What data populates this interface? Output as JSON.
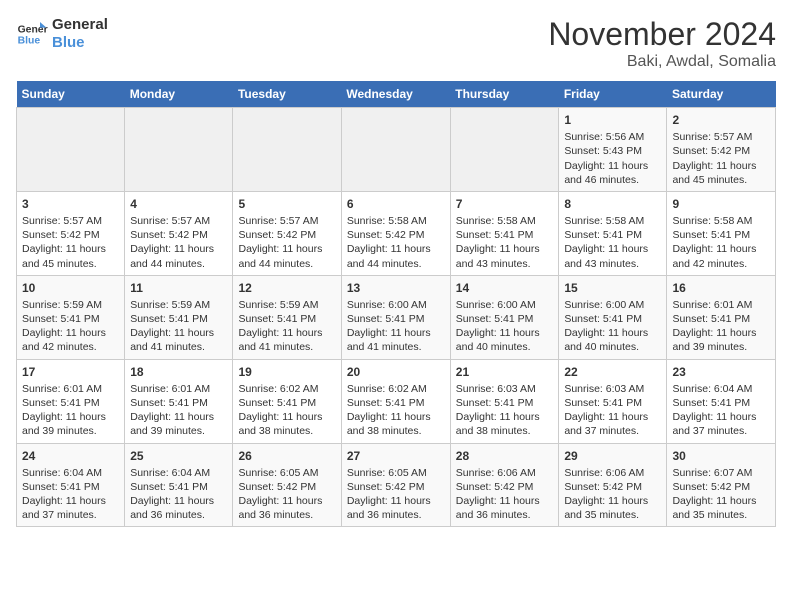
{
  "logo": {
    "line1": "General",
    "line2": "Blue"
  },
  "title": "November 2024",
  "subtitle": "Baki, Awdal, Somalia",
  "headers": [
    "Sunday",
    "Monday",
    "Tuesday",
    "Wednesday",
    "Thursday",
    "Friday",
    "Saturday"
  ],
  "rows": [
    [
      {
        "day": "",
        "info": ""
      },
      {
        "day": "",
        "info": ""
      },
      {
        "day": "",
        "info": ""
      },
      {
        "day": "",
        "info": ""
      },
      {
        "day": "",
        "info": ""
      },
      {
        "day": "1",
        "info": "Sunrise: 5:56 AM\nSunset: 5:43 PM\nDaylight: 11 hours and 46 minutes."
      },
      {
        "day": "2",
        "info": "Sunrise: 5:57 AM\nSunset: 5:42 PM\nDaylight: 11 hours and 45 minutes."
      }
    ],
    [
      {
        "day": "3",
        "info": "Sunrise: 5:57 AM\nSunset: 5:42 PM\nDaylight: 11 hours and 45 minutes."
      },
      {
        "day": "4",
        "info": "Sunrise: 5:57 AM\nSunset: 5:42 PM\nDaylight: 11 hours and 44 minutes."
      },
      {
        "day": "5",
        "info": "Sunrise: 5:57 AM\nSunset: 5:42 PM\nDaylight: 11 hours and 44 minutes."
      },
      {
        "day": "6",
        "info": "Sunrise: 5:58 AM\nSunset: 5:42 PM\nDaylight: 11 hours and 44 minutes."
      },
      {
        "day": "7",
        "info": "Sunrise: 5:58 AM\nSunset: 5:41 PM\nDaylight: 11 hours and 43 minutes."
      },
      {
        "day": "8",
        "info": "Sunrise: 5:58 AM\nSunset: 5:41 PM\nDaylight: 11 hours and 43 minutes."
      },
      {
        "day": "9",
        "info": "Sunrise: 5:58 AM\nSunset: 5:41 PM\nDaylight: 11 hours and 42 minutes."
      }
    ],
    [
      {
        "day": "10",
        "info": "Sunrise: 5:59 AM\nSunset: 5:41 PM\nDaylight: 11 hours and 42 minutes."
      },
      {
        "day": "11",
        "info": "Sunrise: 5:59 AM\nSunset: 5:41 PM\nDaylight: 11 hours and 41 minutes."
      },
      {
        "day": "12",
        "info": "Sunrise: 5:59 AM\nSunset: 5:41 PM\nDaylight: 11 hours and 41 minutes."
      },
      {
        "day": "13",
        "info": "Sunrise: 6:00 AM\nSunset: 5:41 PM\nDaylight: 11 hours and 41 minutes."
      },
      {
        "day": "14",
        "info": "Sunrise: 6:00 AM\nSunset: 5:41 PM\nDaylight: 11 hours and 40 minutes."
      },
      {
        "day": "15",
        "info": "Sunrise: 6:00 AM\nSunset: 5:41 PM\nDaylight: 11 hours and 40 minutes."
      },
      {
        "day": "16",
        "info": "Sunrise: 6:01 AM\nSunset: 5:41 PM\nDaylight: 11 hours and 39 minutes."
      }
    ],
    [
      {
        "day": "17",
        "info": "Sunrise: 6:01 AM\nSunset: 5:41 PM\nDaylight: 11 hours and 39 minutes."
      },
      {
        "day": "18",
        "info": "Sunrise: 6:01 AM\nSunset: 5:41 PM\nDaylight: 11 hours and 39 minutes."
      },
      {
        "day": "19",
        "info": "Sunrise: 6:02 AM\nSunset: 5:41 PM\nDaylight: 11 hours and 38 minutes."
      },
      {
        "day": "20",
        "info": "Sunrise: 6:02 AM\nSunset: 5:41 PM\nDaylight: 11 hours and 38 minutes."
      },
      {
        "day": "21",
        "info": "Sunrise: 6:03 AM\nSunset: 5:41 PM\nDaylight: 11 hours and 38 minutes."
      },
      {
        "day": "22",
        "info": "Sunrise: 6:03 AM\nSunset: 5:41 PM\nDaylight: 11 hours and 37 minutes."
      },
      {
        "day": "23",
        "info": "Sunrise: 6:04 AM\nSunset: 5:41 PM\nDaylight: 11 hours and 37 minutes."
      }
    ],
    [
      {
        "day": "24",
        "info": "Sunrise: 6:04 AM\nSunset: 5:41 PM\nDaylight: 11 hours and 37 minutes."
      },
      {
        "day": "25",
        "info": "Sunrise: 6:04 AM\nSunset: 5:41 PM\nDaylight: 11 hours and 36 minutes."
      },
      {
        "day": "26",
        "info": "Sunrise: 6:05 AM\nSunset: 5:42 PM\nDaylight: 11 hours and 36 minutes."
      },
      {
        "day": "27",
        "info": "Sunrise: 6:05 AM\nSunset: 5:42 PM\nDaylight: 11 hours and 36 minutes."
      },
      {
        "day": "28",
        "info": "Sunrise: 6:06 AM\nSunset: 5:42 PM\nDaylight: 11 hours and 36 minutes."
      },
      {
        "day": "29",
        "info": "Sunrise: 6:06 AM\nSunset: 5:42 PM\nDaylight: 11 hours and 35 minutes."
      },
      {
        "day": "30",
        "info": "Sunrise: 6:07 AM\nSunset: 5:42 PM\nDaylight: 11 hours and 35 minutes."
      }
    ]
  ]
}
